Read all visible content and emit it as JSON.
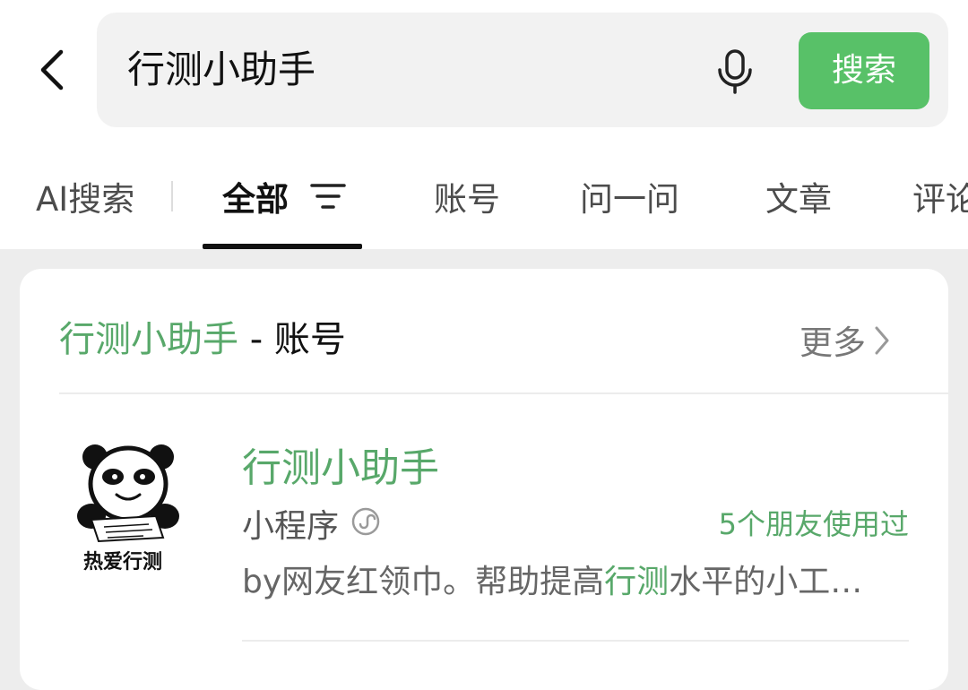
{
  "search": {
    "query": "行测小助手",
    "button_label": "搜索"
  },
  "tabs": [
    {
      "label": "AI搜索",
      "active": false
    },
    {
      "label": "全部",
      "active": true
    },
    {
      "label": "账号",
      "active": false
    },
    {
      "label": "问一问",
      "active": false
    },
    {
      "label": "文章",
      "active": false
    },
    {
      "label": "评论",
      "active": false
    }
  ],
  "section": {
    "title_highlight": "行测小助手",
    "title_suffix": " - 账号",
    "more_label": "更多"
  },
  "account": {
    "avatar_caption": "热爱行测",
    "name": "行测小助手",
    "type": "小程序",
    "friends_used": "5个朋友使用过",
    "desc_prefix": "by网友红领巾。帮助提高",
    "desc_highlight": "行测",
    "desc_suffix": "水平的小工…"
  },
  "colors": {
    "accent": "#58c168",
    "highlight_text": "#58a86a",
    "background": "#ededed"
  },
  "icons": [
    "back-icon",
    "microphone-icon",
    "filter-icon",
    "chevron-right-icon",
    "mini-program-icon"
  ]
}
